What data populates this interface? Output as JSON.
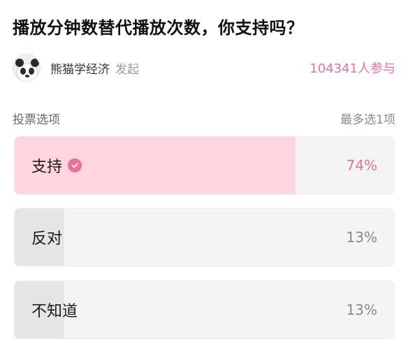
{
  "poll": {
    "title": "播放分钟数替代播放次数，你支持吗？",
    "author": "熊猫学经济",
    "author_action": "发起",
    "participants_count": "104341",
    "participants_unit": "人",
    "participants_label": "参与"
  },
  "options_header": {
    "label": "投票选项",
    "limit": "最多选1项"
  },
  "options": [
    {
      "label": "支持",
      "percent_text": "74%",
      "percent": 74,
      "selected": true,
      "icon": "check-circle-icon"
    },
    {
      "label": "反对",
      "percent_text": "13%",
      "percent": 13,
      "selected": false
    },
    {
      "label": "不知道",
      "percent_text": "13%",
      "percent": 13,
      "selected": false
    }
  ],
  "colors": {
    "accent": "#e8729a",
    "selected_fill": "#ffd6e0",
    "unselected_fill": "#e4e5e7",
    "option_bg": "#f4f4f5"
  }
}
